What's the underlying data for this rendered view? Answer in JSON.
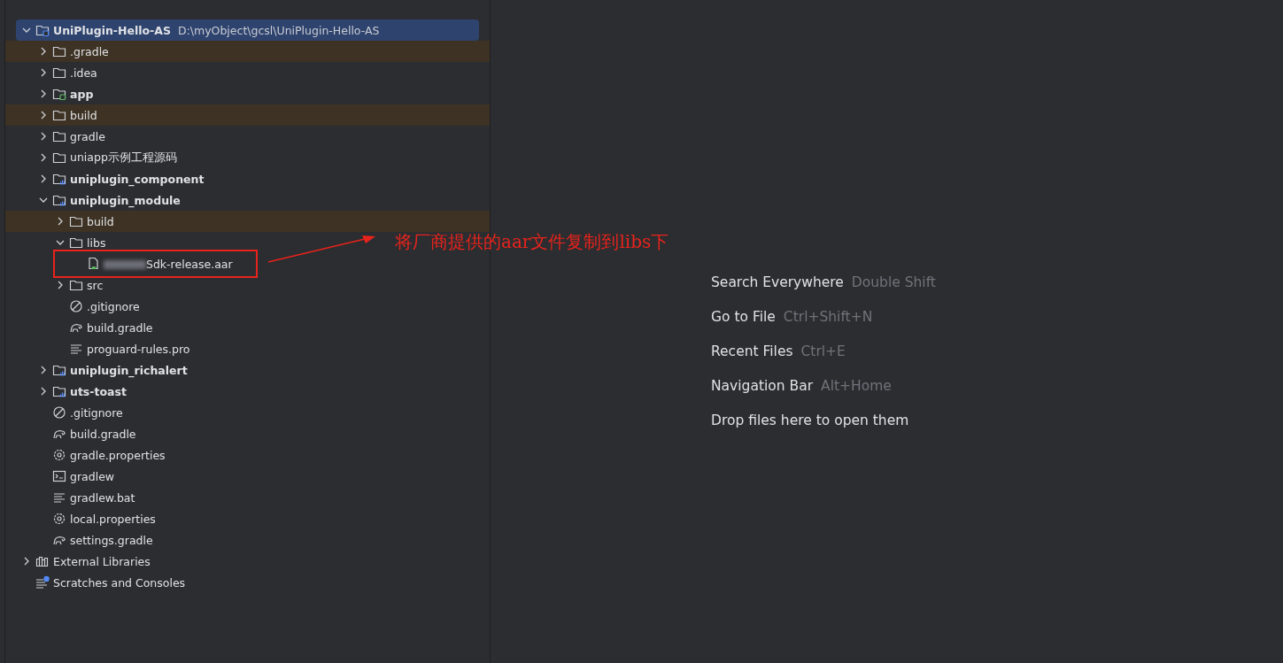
{
  "project_tree": [
    {
      "label": "UniPlugin-Hello-AS",
      "kind": "project",
      "bold": true,
      "hint": "D:\\myObject\\gcsl\\UniPlugin-Hello-AS",
      "expanded": true,
      "selected": true,
      "excluded": false,
      "children": [
        {
          "label": ".gradle",
          "kind": "folder",
          "bold": false,
          "expanded": false,
          "selected": false,
          "excluded": true
        },
        {
          "label": ".idea",
          "kind": "folder",
          "bold": false,
          "expanded": false,
          "selected": false,
          "excluded": false
        },
        {
          "label": "app",
          "kind": "app_module",
          "bold": true,
          "expanded": false,
          "selected": false,
          "excluded": false
        },
        {
          "label": "build",
          "kind": "folder",
          "bold": false,
          "expanded": false,
          "selected": false,
          "excluded": true
        },
        {
          "label": "gradle",
          "kind": "folder",
          "bold": false,
          "expanded": false,
          "selected": false,
          "excluded": false
        },
        {
          "label": "uniapp示例工程源码",
          "kind": "folder",
          "bold": false,
          "expanded": false,
          "selected": false,
          "excluded": false
        },
        {
          "label": "uniplugin_component",
          "kind": "module",
          "bold": true,
          "expanded": false,
          "selected": false,
          "excluded": false
        },
        {
          "label": "uniplugin_module",
          "kind": "module",
          "bold": true,
          "expanded": true,
          "selected": false,
          "excluded": false,
          "children": [
            {
              "label": "build",
              "kind": "folder",
              "bold": false,
              "expanded": false,
              "selected": false,
              "excluded": true
            },
            {
              "label": "libs",
              "kind": "folder",
              "bold": false,
              "expanded": true,
              "selected": false,
              "excluded": false,
              "children": [
                {
                  "label": "Sdk-release.aar",
                  "kind": "aar",
                  "bold": false,
                  "selected": false,
                  "excluded": false,
                  "redacted": true,
                  "annotated": true
                }
              ]
            },
            {
              "label": "src",
              "kind": "folder",
              "bold": false,
              "expanded": false,
              "selected": false,
              "excluded": false
            },
            {
              "label": ".gitignore",
              "kind": "ignore",
              "bold": false,
              "selected": false,
              "excluded": false
            },
            {
              "label": "build.gradle",
              "kind": "gradle",
              "bold": false,
              "selected": false,
              "excluded": false
            },
            {
              "label": "proguard-rules.pro",
              "kind": "text",
              "bold": false,
              "selected": false,
              "excluded": false
            }
          ]
        },
        {
          "label": "uniplugin_richalert",
          "kind": "module",
          "bold": true,
          "expanded": false,
          "selected": false,
          "excluded": false
        },
        {
          "label": "uts-toast",
          "kind": "module",
          "bold": true,
          "expanded": false,
          "selected": false,
          "excluded": false
        },
        {
          "label": ".gitignore",
          "kind": "ignore",
          "bold": false,
          "selected": false,
          "excluded": false
        },
        {
          "label": "build.gradle",
          "kind": "gradle",
          "bold": false,
          "selected": false,
          "excluded": false
        },
        {
          "label": "gradle.properties",
          "kind": "settings",
          "bold": false,
          "selected": false,
          "excluded": false
        },
        {
          "label": "gradlew",
          "kind": "terminal",
          "bold": false,
          "selected": false,
          "excluded": false
        },
        {
          "label": "gradlew.bat",
          "kind": "text",
          "bold": false,
          "selected": false,
          "excluded": false
        },
        {
          "label": "local.properties",
          "kind": "settings",
          "bold": false,
          "selected": false,
          "excluded": false
        },
        {
          "label": "settings.gradle",
          "kind": "gradle",
          "bold": false,
          "selected": false,
          "excluded": false
        }
      ]
    },
    {
      "label": "External Libraries",
      "kind": "library",
      "bold": false,
      "expanded": false,
      "selected": false,
      "excluded": false
    },
    {
      "label": "Scratches and Consoles",
      "kind": "scratches",
      "bold": false,
      "selected": false,
      "excluded": false
    }
  ],
  "annotation": "将厂商提供的aar文件复制到libs下",
  "editor_hints": [
    {
      "action": "Search Everywhere",
      "shortcut": "Double Shift"
    },
    {
      "action": "Go to File",
      "shortcut": "Ctrl+Shift+N"
    },
    {
      "action": "Recent Files",
      "shortcut": "Ctrl+E"
    },
    {
      "action": "Navigation Bar",
      "shortcut": "Alt+Home"
    },
    {
      "action": "Drop files here to open them"
    }
  ]
}
